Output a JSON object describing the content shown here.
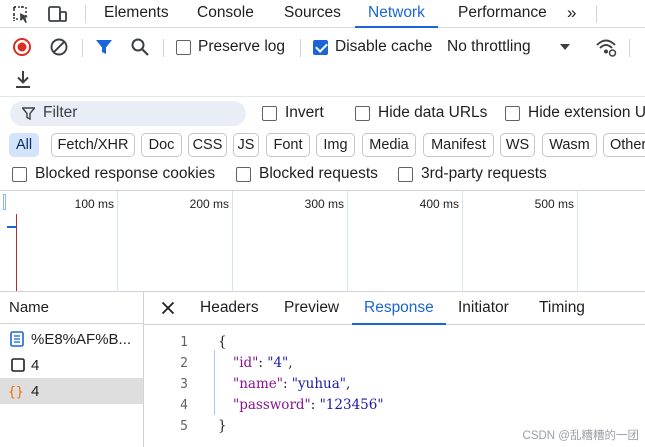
{
  "tabs": {
    "items": [
      "Elements",
      "Console",
      "Sources",
      "Network",
      "Performance"
    ],
    "active": "Network",
    "more": "»"
  },
  "toolbar": {
    "preserve_log": "Preserve log",
    "disable_cache": "Disable cache",
    "throttling": "No throttling",
    "preserve_log_checked": false,
    "disable_cache_checked": true
  },
  "filter": {
    "placeholder": "Filter",
    "invert": "Invert",
    "hide_data_urls": "Hide data URLs",
    "hide_extension": "Hide extension U"
  },
  "type_filters": {
    "items": [
      "All",
      "Fetch/XHR",
      "Doc",
      "CSS",
      "JS",
      "Font",
      "Img",
      "Media",
      "Manifest",
      "WS",
      "Wasm",
      "Other"
    ],
    "active": "All"
  },
  "options": {
    "blocked_cookies": "Blocked response cookies",
    "blocked_requests": "Blocked requests",
    "third_party": "3rd-party requests"
  },
  "timeline": {
    "labels": [
      "100 ms",
      "200 ms",
      "300 ms",
      "400 ms",
      "500 ms"
    ]
  },
  "requests": {
    "header": "Name",
    "items": [
      {
        "name": "%E8%AF%B...",
        "icon": "document-icon"
      },
      {
        "name": "4",
        "icon": "checkbox-icon"
      },
      {
        "name": "4",
        "icon": "xhr-icon"
      }
    ],
    "selected_index": 2
  },
  "details": {
    "tabs": [
      "Headers",
      "Preview",
      "Response",
      "Initiator",
      "Timing"
    ],
    "active": "Response",
    "line_numbers": [
      "1",
      "2",
      "3",
      "4",
      "5"
    ],
    "lines": {
      "open": "{",
      "l2_key": "\"id\"",
      "l2_val": "\"4\"",
      "l3_key": "\"name\"",
      "l3_val": "\"yuhua\"",
      "l4_key": "\"password\"",
      "l4_val": "\"123456\"",
      "close": "}",
      "colon": ": ",
      "comma": ","
    }
  },
  "watermark": "CSDN @乱糟糟的一团",
  "colors": {
    "accent": "#1a66d6",
    "record": "#d93025",
    "filter_icon": "#1a66d6",
    "xhr": "#e8710a"
  }
}
